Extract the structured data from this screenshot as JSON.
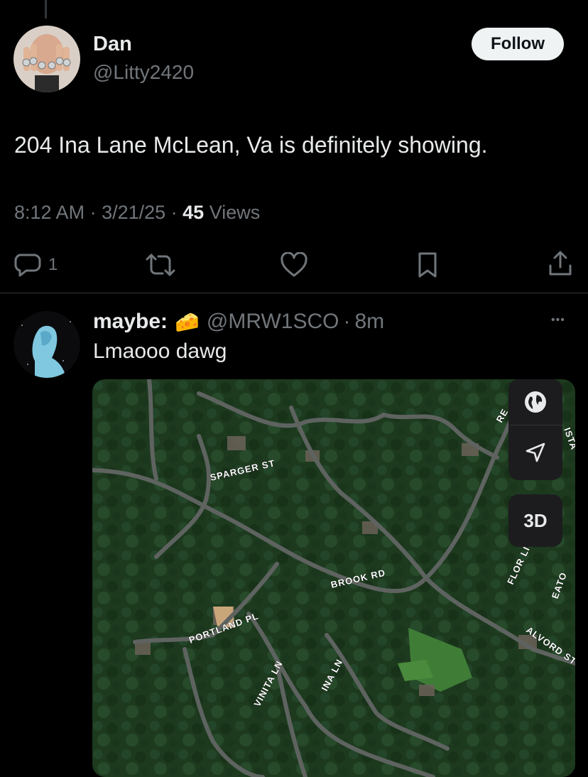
{
  "tweet": {
    "author_name": "Dan",
    "author_handle": "@Litty2420",
    "follow_label": "Follow",
    "text": "204 Ina Lane McLean, Va is definitely showing.",
    "time": "8:12 AM",
    "date": "3/21/25",
    "views_count": "45",
    "views_label": "Views",
    "reply_count": "1",
    "meta_sep": " · "
  },
  "reply": {
    "name": "maybe:",
    "emoji": "🧀",
    "handle": "@MRW1SCO",
    "sep": "·",
    "age": "8m",
    "text": "Lmaooo dawg",
    "more_label": "•••"
  },
  "map": {
    "button_3d": "3D",
    "labels": {
      "sparger": "SPARGER ST",
      "brook": "BROOK RD",
      "portland": "PORTLAND PL",
      "vinita": "VINITA LN",
      "ina": "INA LN",
      "flor": "FLOR LI",
      "alvord": "ALVORD ST",
      "eato": "EATO",
      "ista": "ISTA",
      "re": "RE"
    }
  },
  "colors": {
    "background": "#000000",
    "primary_text": "#e7e9ea",
    "secondary_text": "#71767b",
    "follow_bg": "#eff3f4"
  },
  "icons": [
    "reply-icon",
    "retweet-icon",
    "like-icon",
    "bookmark-icon",
    "share-icon",
    "globe-icon",
    "location-arrow-icon",
    "more-icon"
  ]
}
